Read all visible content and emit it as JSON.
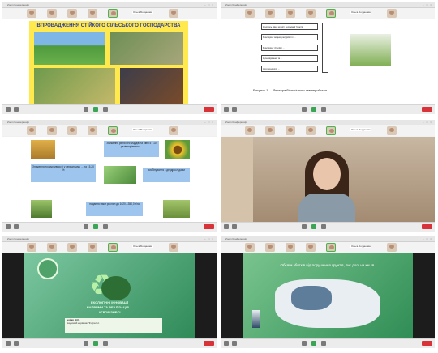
{
  "window_title": "Zoom Конференція",
  "presenter_name": "Ольга Богданова",
  "cells": [
    {
      "title": "ВПРОВАДЖЕННЯ СТІЙКОГО СІЛЬСЬКОГО ГОСПОДАРСТВА"
    },
    {
      "boxes": [
        "Контроль рівня ерозії і деградації ґрунтів",
        "Моніторинг водних ресурсів і їх ...",
        "Моніторинг ґрунтів і  ...",
        "Культивування та ...",
        "Агротехнологія ..."
      ],
      "caption": "Рисунок 1 — Фактори біологічного землеробства"
    },
    {
      "texts": [
        "Зниження рівня пестицидів на рівні 5 - 10 разів порівняно ...",
        "Зниження продуктивності у середньому ... на 15-20 %",
        "комбінування з дендрослідами",
        "надання маси рослин до 1020-1350,0 т/га"
      ]
    },
    {},
    {
      "title_lines": [
        "ЕКОЛОГІЧНІ ІННОВАЦІЇ",
        "НАПРЯМИ ТА РЕАЛІЗАЦІЯ ...",
        "АГРОБІЗНЕСІ"
      ],
      "author": "Бойко М.О.",
      "supervisor": "Науковий керівник Пічура В.І."
    },
    {
      "title": "Обсяги збитків від порушення ґрунтів, тис.дол. на км кв."
    }
  ]
}
